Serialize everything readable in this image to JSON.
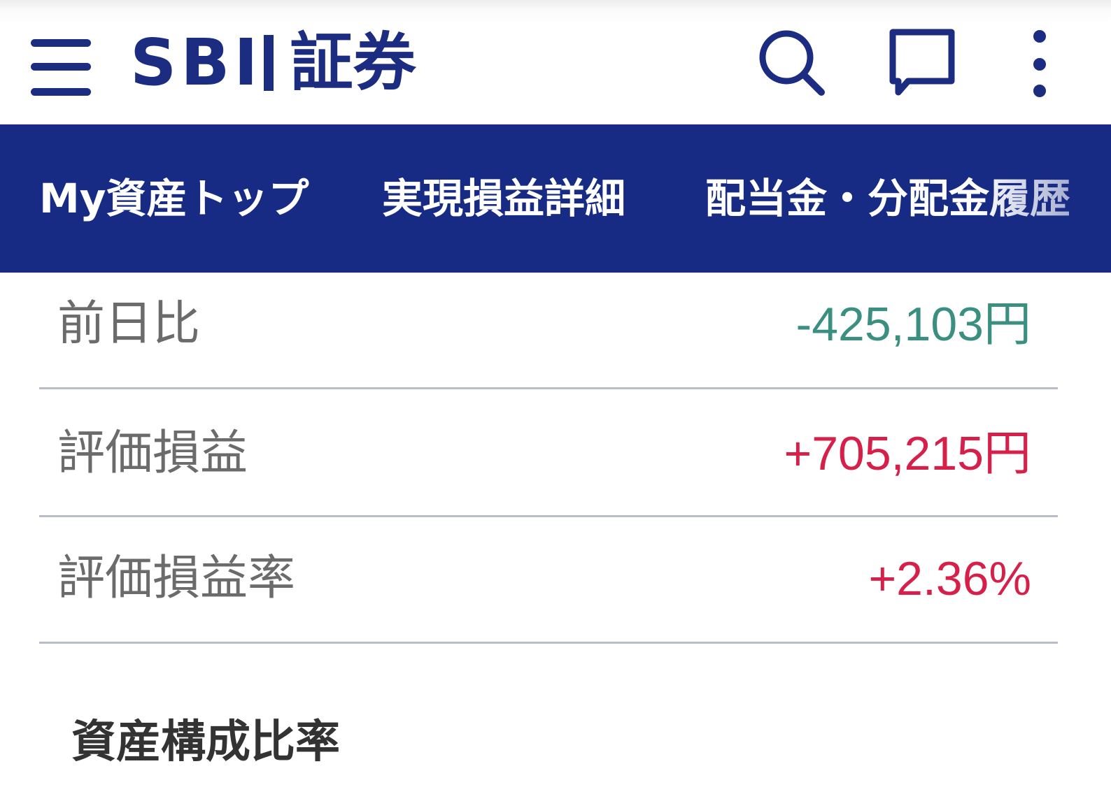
{
  "header": {
    "logo_latin": "SBI",
    "logo_kanji": "証券",
    "icons": [
      "hamburger-menu-icon",
      "search-icon",
      "chat-bubble-icon",
      "more-vertical-icon"
    ]
  },
  "tabs": [
    {
      "label": "My資産トップ"
    },
    {
      "label": "実現損益詳細"
    },
    {
      "label": "配当金・分配金履歴"
    }
  ],
  "summary": [
    {
      "label": "前日比",
      "value": "-425,103円",
      "sign": "negative"
    },
    {
      "label": "評価損益",
      "value": "+705,215円",
      "sign": "positive"
    },
    {
      "label": "評価損益率",
      "value": "+2.36%",
      "sign": "positive"
    }
  ],
  "section": {
    "title": "資産構成比率"
  },
  "colors": {
    "brand_navy": "#1c2c80",
    "tab_bar": "#172a84",
    "negative": "#3a8f80",
    "positive": "#d6204a",
    "divider": "#b8bec8",
    "label_gray": "#6b6b6b"
  }
}
